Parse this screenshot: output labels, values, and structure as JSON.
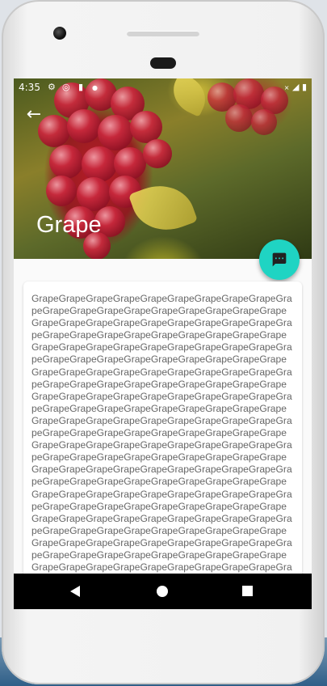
{
  "status_bar": {
    "time": "4:35",
    "icons": [
      "settings-icon",
      "data-saver-icon",
      "sd-card-icon",
      "dot-icon"
    ],
    "right_icons": [
      "wifi-icon",
      "signal-icon",
      "battery-icon"
    ]
  },
  "header": {
    "title": "Grape",
    "back_icon": "arrow-back-icon",
    "image": "grape-cluster-photo"
  },
  "fab": {
    "icon": "message-icon",
    "color": "#1fd4c3"
  },
  "content": {
    "text": "GrapeGrapeGrapeGrapeGrapeGrapeGrapeGrapeGrapeGrapeGrapeGrapeGrapeGrapeGrapeGrapeGrapeGrapeGrapeGrapeGrapeGrapeGrapeGrapeGrapeGrapeGrapeGrapeGrapeGrapeGrapeGrapeGrapeGrapeGrapeGrapeGrapeGrapeGrapeGrapeGrapeGrapeGrapeGrapeGrapeGrapeGrapeGrapeGrapeGrapeGrapeGrapeGrapeGrapeGrapeGrapeGrapeGrapeGrapeGrapeGrapeGrapeGrapeGrapeGrapeGrapeGrapeGrapeGrapeGrapeGrapeGrapeGrapeGrapeGrapeGrapeGrapeGrapeGrapeGrapeGrapeGrapeGrapeGrapeGrapeGrapeGrapeGrapeGrapeGrapeGrapeGrapeGrapeGrapeGrapeGrapeGrapeGrapeGrapeGrapeGrapeGrapeGrapeGrapeGrapeGrapeGrapeGrapeGrapeGrapeGrapeGrapeGrapeGrapeGrapeGrapeGrapeGrapeGrapeGrapeGrapeGrapeGrapeGrapeGrapeGrapeGrapeGrapeGrapeGrapeGrapeGrapeGrapeGrapeGrapeGrapeGrapeGrapeGrapeGrapeGrapeGrapeGrapeGrapeGrapeGrapeGrapeGrapeGrapeGrapeGrapeGrapeGrapeGrapeGrapeGrapeGrapeGrapeGrapeGrapeGrapeGrapeGrapeGrapeGrapeGrapeGrapeGrapeGrapeGrapeGrapeGrapeGrapeGrapeGrapeGrapeGrapeGrapeGrapeGrapeGrapeGrapeGrapeGrapeGrapeGrapeGrapeGrapeGrapeGrapeGrapeGrapeGrapeGrapeGrapeGrapeGrapeGrapeGrapeGrapeGrapeGrapeGrapeGrapeGrapeGrapeGrapeGrapeGrapeGrapeGrapeGrapeGrapeGrapeGrapeGrapeGrapeGrapeGrapeGrapeGrapeGrapeGrapeGrapeGrapeGrapeGrapeGrapeGrapeGrapeGrapeGrapeGrapeGrapeGrapeGrapeGrapeGrapeGrapeGrapeGrapeGrapeGrapeGrapeGrapeGrapeGrapeGrapeGrapeGrapeGrapeGrapeGrapeGrapeGrapeGrapeGrapeGrapeGrapeGrapeGrapeGrapeGrapeGrapeGrapeGrapeGrapeGrapeGrapeGrapeGrapeGrapeGrapeGrapeGrapeGrapeGrapeGrapeGrapeGrapeGrapeGrapeGrapeGrapeGrapeGrapeGrapeGrapeGrapeGrapeGrapeGrapeGrapeGrapeGrapeGrapeGrapeGrapeGrapeGrapeGrapeGrapeGrapeGrapeGrapeGrapeGrapeGrapeGrapeGrapeGrapeGrapeGrapeGrapeGrapeGrapeGrapeGrapeGrape"
  },
  "navbar": {
    "back_icon": "nav-back-icon",
    "home_icon": "nav-home-icon",
    "recents_icon": "nav-recents-icon"
  }
}
